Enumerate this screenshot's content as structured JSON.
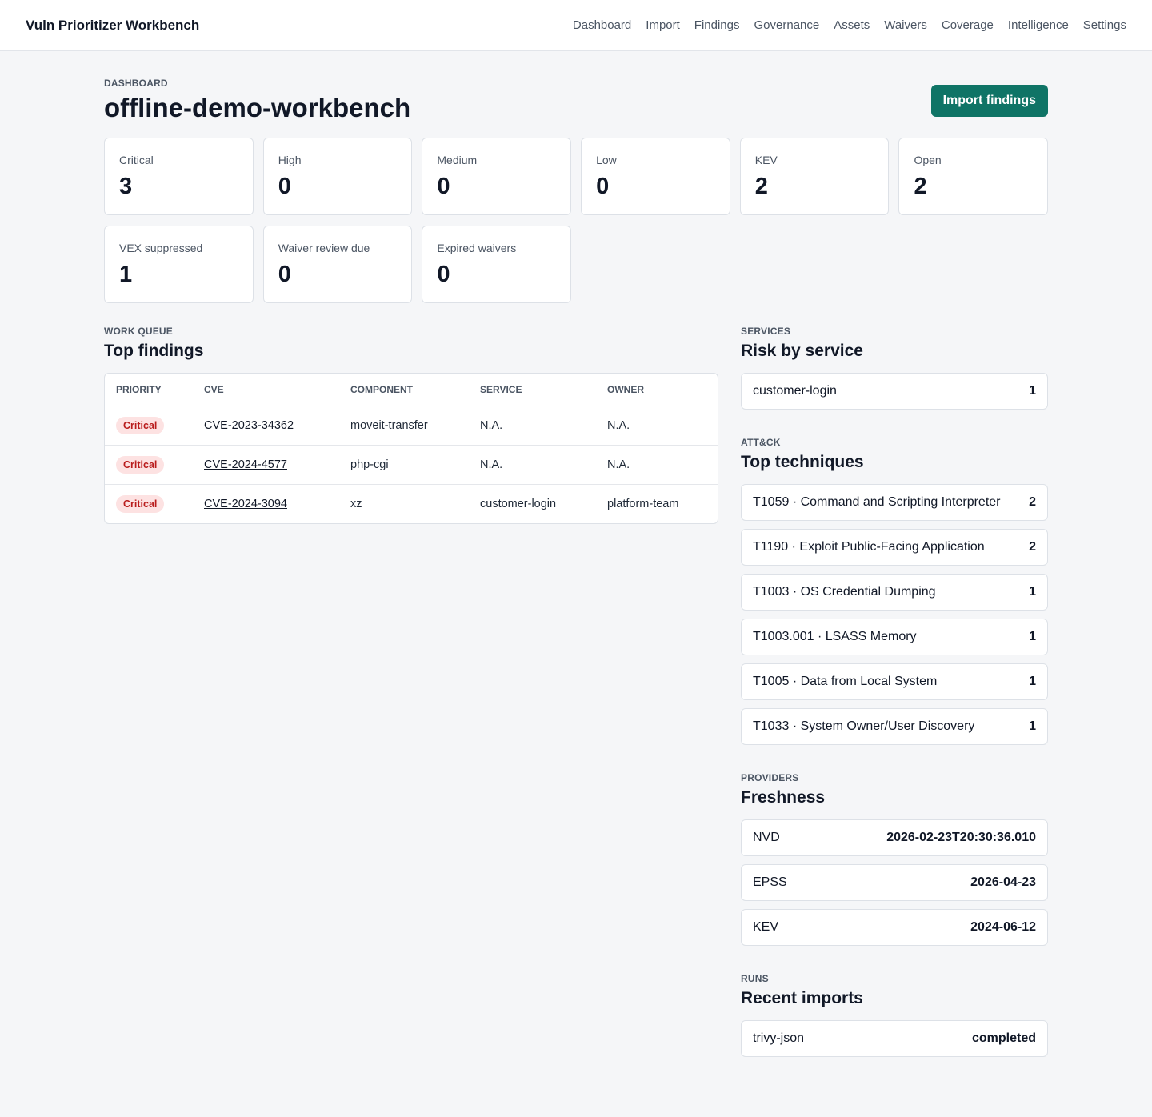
{
  "app": {
    "title": "Vuln Prioritizer Workbench"
  },
  "nav": [
    "Dashboard",
    "Import",
    "Findings",
    "Governance",
    "Assets",
    "Waivers",
    "Coverage",
    "Intelligence",
    "Settings"
  ],
  "header": {
    "eyebrow": "DASHBOARD",
    "title": "offline-demo-workbench",
    "import_button": "Import findings"
  },
  "stats": [
    {
      "label": "Critical",
      "value": "3"
    },
    {
      "label": "High",
      "value": "0"
    },
    {
      "label": "Medium",
      "value": "0"
    },
    {
      "label": "Low",
      "value": "0"
    },
    {
      "label": "KEV",
      "value": "2"
    },
    {
      "label": "Open",
      "value": "2"
    },
    {
      "label": "VEX suppressed",
      "value": "1"
    },
    {
      "label": "Waiver review due",
      "value": "0"
    },
    {
      "label": "Expired waivers",
      "value": "0"
    }
  ],
  "work_queue": {
    "eyebrow": "WORK QUEUE",
    "title": "Top findings",
    "columns": [
      "PRIORITY",
      "CVE",
      "COMPONENT",
      "SERVICE",
      "OWNER"
    ],
    "rows": [
      {
        "priority": "Critical",
        "cve": "CVE-2023-34362",
        "component": "moveit-transfer",
        "service": "N.A.",
        "owner": "N.A."
      },
      {
        "priority": "Critical",
        "cve": "CVE-2024-4577",
        "component": "php-cgi",
        "service": "N.A.",
        "owner": "N.A."
      },
      {
        "priority": "Critical",
        "cve": "CVE-2024-3094",
        "component": "xz",
        "service": "customer-login",
        "owner": "platform-team"
      }
    ]
  },
  "services": {
    "eyebrow": "SERVICES",
    "title": "Risk by service",
    "items": [
      {
        "label": "customer-login",
        "value": "1"
      }
    ]
  },
  "attack": {
    "eyebrow": "ATT&CK",
    "title": "Top techniques",
    "items": [
      {
        "label": "T1059 · Command and Scripting Interpreter",
        "value": "2"
      },
      {
        "label": "T1190 · Exploit Public-Facing Application",
        "value": "2"
      },
      {
        "label": "T1003 · OS Credential Dumping",
        "value": "1"
      },
      {
        "label": "T1003.001 · LSASS Memory",
        "value": "1"
      },
      {
        "label": "T1005 · Data from Local System",
        "value": "1"
      },
      {
        "label": "T1033 · System Owner/User Discovery",
        "value": "1"
      }
    ]
  },
  "providers": {
    "eyebrow": "PROVIDERS",
    "title": "Freshness",
    "items": [
      {
        "label": "NVD",
        "value": "2026-02-23T20:30:36.010"
      },
      {
        "label": "EPSS",
        "value": "2026-04-23"
      },
      {
        "label": "KEV",
        "value": "2024-06-12"
      }
    ]
  },
  "runs": {
    "eyebrow": "RUNS",
    "title": "Recent imports",
    "items": [
      {
        "label": "trivy-json",
        "value": "completed"
      }
    ]
  }
}
